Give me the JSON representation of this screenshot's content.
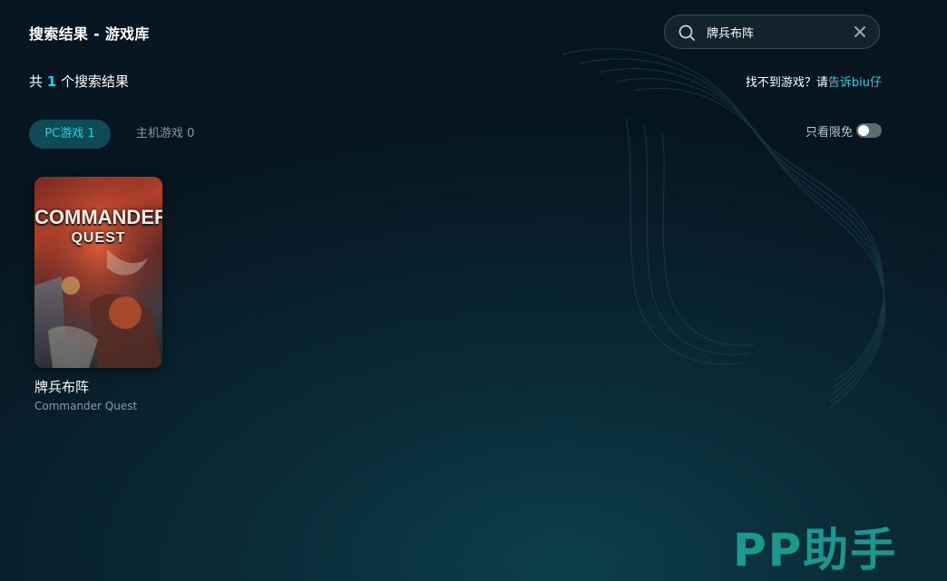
{
  "header": {
    "title": "搜索结果 - 游戏库"
  },
  "search": {
    "value": "牌兵布阵",
    "placeholder": ""
  },
  "results": {
    "prefix": "共",
    "count": "1",
    "suffix": "个搜索结果"
  },
  "feedback": {
    "text": "找不到游戏？请",
    "link": "告诉biu仔"
  },
  "tabs": [
    {
      "label": "PC游戏 1",
      "active": true
    },
    {
      "label": "主机游戏 0",
      "active": false
    }
  ],
  "filter": {
    "free_only_label": "只看限免",
    "free_only_on": false
  },
  "games": [
    {
      "cover_logo_line1": "COMMANDER",
      "cover_logo_line2": "QUEST",
      "name": "牌兵布阵",
      "subname": "Commander Quest"
    }
  ],
  "watermark": "PP助手",
  "colors": {
    "accent": "#22d3e6",
    "tab_active_bg": "#0f4a57",
    "muted": "#8b98a0",
    "watermark": "#1fa39a"
  }
}
